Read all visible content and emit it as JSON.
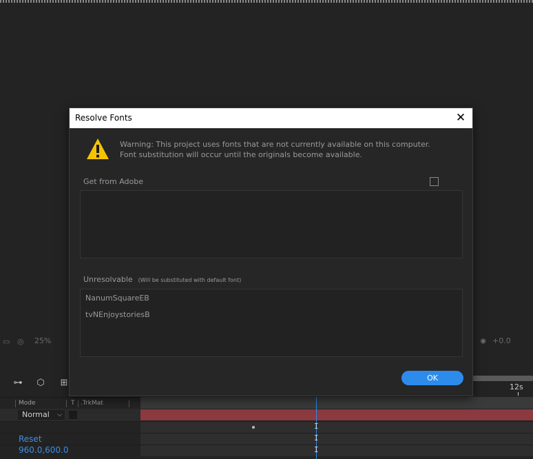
{
  "dialog": {
    "title": "Resolve Fonts",
    "close_glyph": "✕",
    "warning": "Warning: This project uses fonts that are not currently available on this computer. Font substitution will occur until the originals become available.",
    "get_from_adobe_label": "Get from Adobe",
    "unresolvable_label": "Unresolvable",
    "unresolvable_note": "(Will be substituted with default font)",
    "unresolvable_fonts": [
      "NanumSquareEB",
      "tvNEnjoystoriesB"
    ],
    "ok_label": "OK"
  },
  "viewer_bar": {
    "zoom": "25%",
    "exposure": "+0.0"
  },
  "timeline": {
    "time_marker": "12s",
    "columns": {
      "mode": "Mode",
      "t": "T",
      "trkmat": ".TrkMat"
    },
    "mode_value": "Normal",
    "prop_reset": "Reset",
    "prop_position": "960.0,600.0"
  },
  "colors": {
    "accent": "#2d8ceb",
    "layer_bar": "#8b3a40",
    "warning_yellow": "#f5c400"
  },
  "icons": {
    "warning": "warning-triangle-icon",
    "close": "close-icon"
  }
}
